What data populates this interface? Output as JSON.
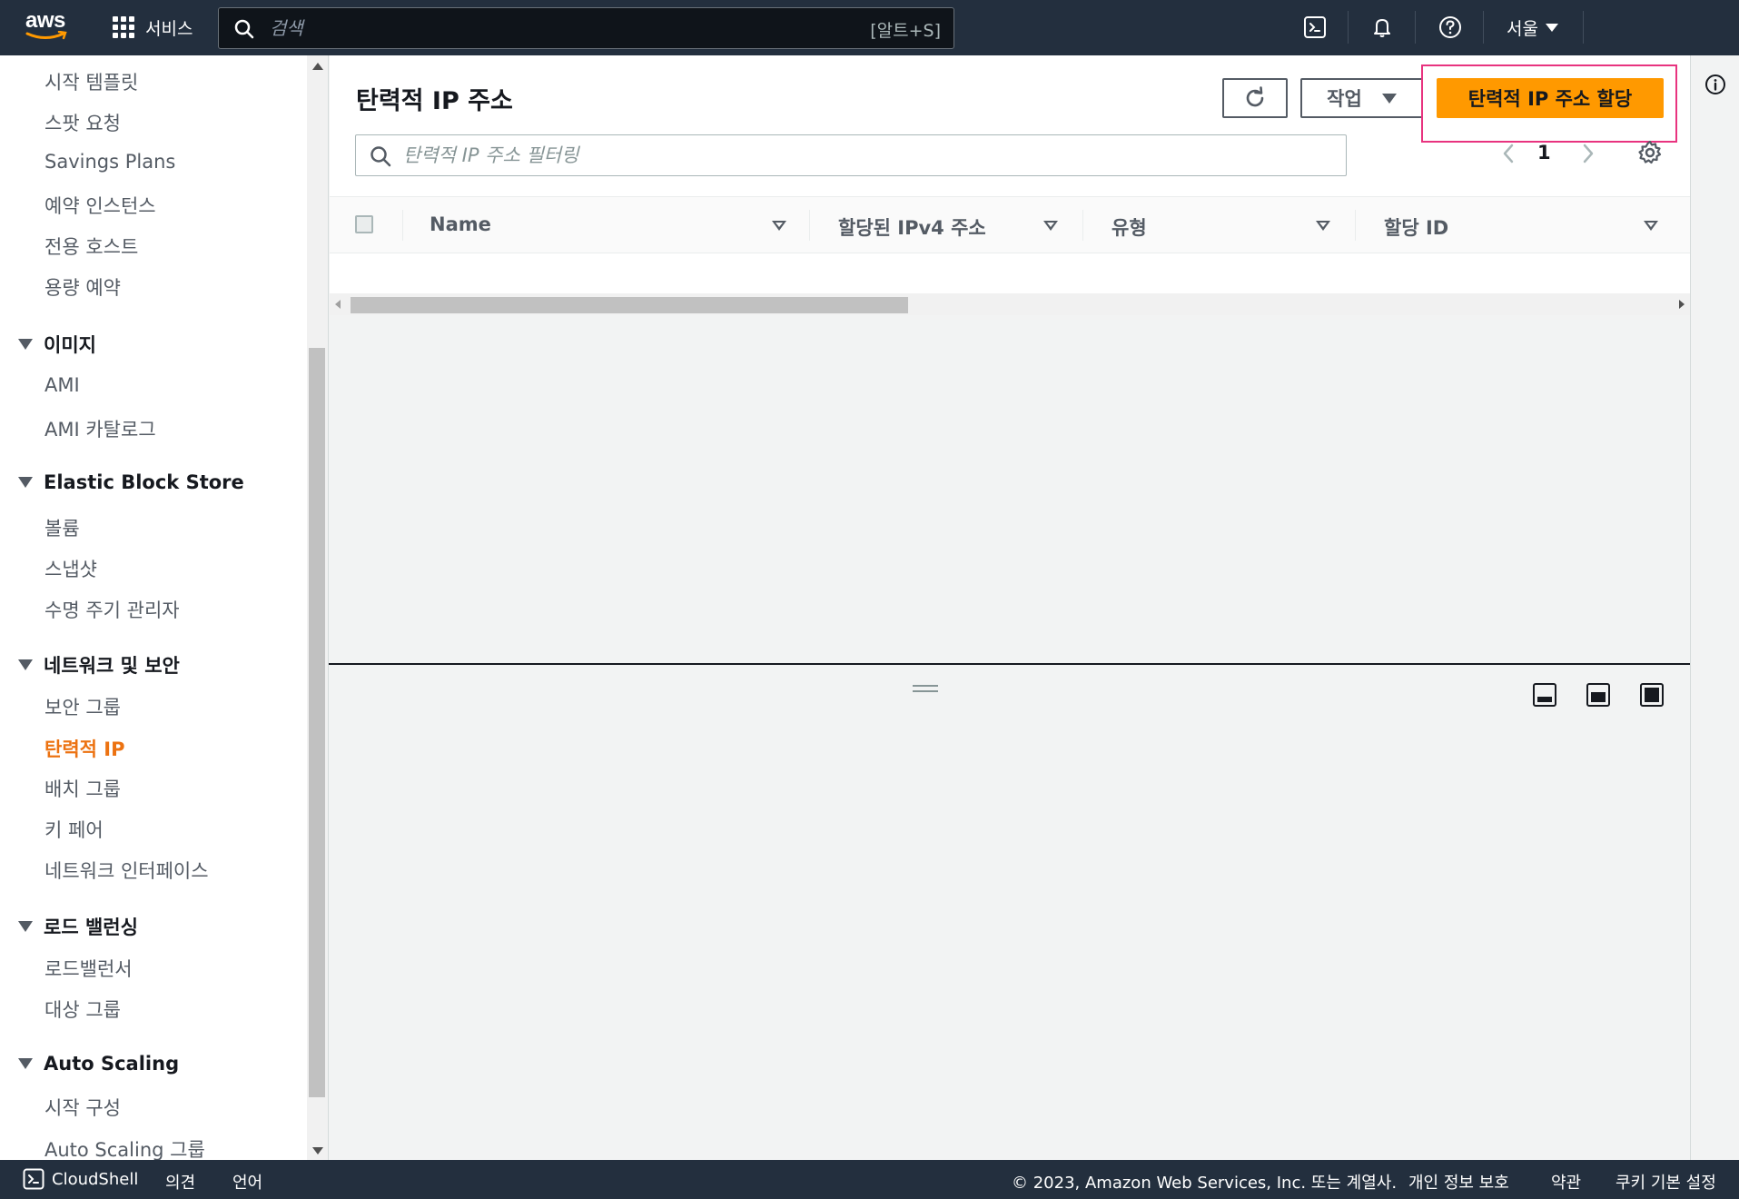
{
  "topnav": {
    "logo_text": "aws",
    "services_label": "서비스",
    "search_placeholder": "검색",
    "search_shortcut": "[알트+S]",
    "region": "서울"
  },
  "sidebar": {
    "items_top": [
      "시작 템플릿",
      "스팟 요청",
      "Savings Plans",
      "예약 인스턴스",
      "전용 호스트",
      "용량 예약"
    ],
    "sections": [
      {
        "title": "이미지",
        "items": [
          "AMI",
          "AMI 카탈로그"
        ]
      },
      {
        "title": "Elastic Block Store",
        "items": [
          "볼륨",
          "스냅샷",
          "수명 주기 관리자"
        ]
      },
      {
        "title": "네트워크 및 보안",
        "items": [
          "보안 그룹",
          "탄력적 IP",
          "배치 그룹",
          "키 페어",
          "네트워크 인터페이스"
        ]
      },
      {
        "title": "로드 밸런싱",
        "items": [
          "로드밸런서",
          "대상 그룹"
        ]
      },
      {
        "title": "Auto Scaling",
        "items": [
          "시작 구성",
          "Auto Scaling 그룹"
        ]
      }
    ],
    "active_item": "탄력적 IP"
  },
  "main": {
    "title": "탄력적 IP 주소",
    "actions_label": "작업",
    "primary_label": "탄력적 IP 주소 할당",
    "filter_placeholder": "탄력적 IP 주소 필터링",
    "page_number": "1",
    "columns": [
      "Name",
      "할당된 IPv4 주소",
      "유형",
      "할당 ID"
    ]
  },
  "footer": {
    "cloudshell": "CloudShell",
    "feedback": "의견",
    "language": "언어",
    "copyright": "© 2023, Amazon Web Services, Inc. 또는 계열사.",
    "privacy": "개인 정보 보호",
    "terms": "약관",
    "cookies": "쿠키 기본 설정"
  },
  "colors": {
    "nav_bg": "#232f3e",
    "primary_button": "#ff9900",
    "active_link": "#ec7211",
    "highlight_border": "#e8337f"
  }
}
